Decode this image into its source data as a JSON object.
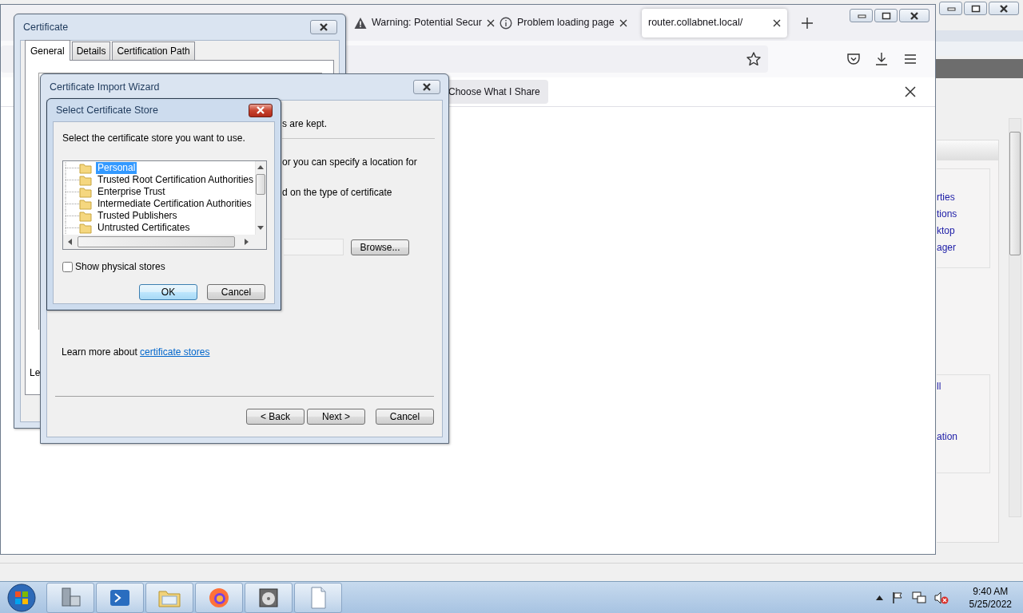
{
  "background_window": {
    "links": [
      "rties",
      "tions",
      "ktop",
      "ager"
    ],
    "links_lower": [
      "ll",
      "ation"
    ]
  },
  "browser": {
    "tabs": [
      {
        "label": "Warning: Potential Secur",
        "kind": "warning",
        "selected": false
      },
      {
        "label": "Problem loading page",
        "kind": "info",
        "selected": false
      },
      {
        "label": "router.collabnet.local/",
        "kind": "page",
        "selected": true
      }
    ],
    "notification": {
      "button": "Choose What I Share"
    }
  },
  "certificate_window": {
    "title": "Certificate",
    "tabs": [
      {
        "label": "General",
        "selected": true
      },
      {
        "label": "Details",
        "selected": false
      },
      {
        "label": "Certification Path",
        "selected": false
      }
    ],
    "body_text": "Le"
  },
  "import_wizard": {
    "title": "Certificate Import Wizard",
    "fragments": [
      "s are kept.",
      "or you can specify a location for",
      "d on the type of certificate"
    ],
    "browse_button": "Browse...",
    "learn_more": "Learn more about",
    "learn_more_link": "certificate stores",
    "buttons": [
      "< Back",
      "Next >",
      "Cancel"
    ]
  },
  "store_dialog": {
    "title": "Select Certificate Store",
    "prompt": "Select the certificate store you want to use.",
    "stores": [
      {
        "label": "Personal",
        "selected": true
      },
      {
        "label": "Trusted Root Certification Authorities",
        "selected": false
      },
      {
        "label": "Enterprise Trust",
        "selected": false
      },
      {
        "label": "Intermediate Certification Authorities",
        "selected": false
      },
      {
        "label": "Trusted Publishers",
        "selected": false
      },
      {
        "label": "Untrusted Certificates",
        "selected": false
      }
    ],
    "show_physical_stores": {
      "label": "Show physical stores",
      "checked": false
    },
    "buttons": [
      "OK",
      "Cancel"
    ]
  },
  "taskbar": {
    "time": "9:40 AM",
    "date": "5/25/2022"
  }
}
